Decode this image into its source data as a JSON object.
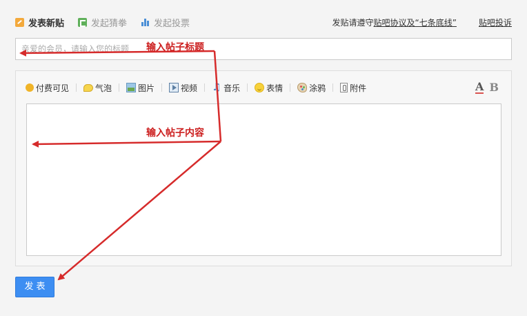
{
  "tabs": [
    {
      "label": "发表新贴",
      "icon": "post-icon",
      "active": true
    },
    {
      "label": "发起猜拳",
      "icon": "guess-icon",
      "active": false
    },
    {
      "label": "发起投票",
      "icon": "vote-icon",
      "active": false
    }
  ],
  "notice": {
    "prefix": "发贴请遵守",
    "rules_link": "贴吧协议及“七条底线”",
    "report_link": "贴吧投诉"
  },
  "title_input": {
    "value": "",
    "placeholder": "亲爱的会员，请输入您的标题"
  },
  "toolbar": {
    "items": [
      {
        "label": "付费可见",
        "icon": "coin-icon"
      },
      {
        "label": "气泡",
        "icon": "bubble-icon"
      },
      {
        "label": "图片",
        "icon": "image-icon"
      },
      {
        "label": "视频",
        "icon": "video-icon"
      },
      {
        "label": "音乐",
        "icon": "music-icon"
      },
      {
        "label": "表情",
        "icon": "emoji-icon"
      },
      {
        "label": "涂鸦",
        "icon": "palette-icon"
      },
      {
        "label": "附件",
        "icon": "attachment-icon"
      }
    ],
    "font_color_label": "A",
    "bold_label": "B"
  },
  "submit": {
    "label": "发表"
  },
  "annotations": {
    "title_hint": "输入帖子标题",
    "content_hint": "输入帖子内容"
  },
  "colors": {
    "accent": "#3d8ef2",
    "annotation": "#cc1f1f"
  }
}
